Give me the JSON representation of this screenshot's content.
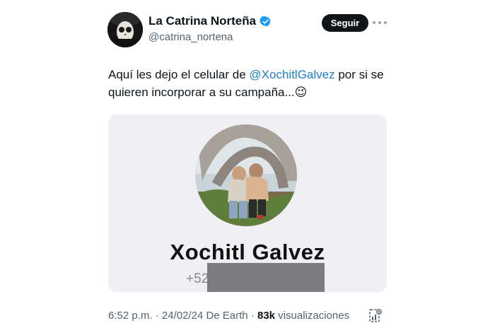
{
  "author": {
    "display_name": "La Catrina Norteña",
    "handle": "@catrina_nortena",
    "verified_icon": "verified-badge-icon",
    "accent_color": "#1d9bf0"
  },
  "follow_button": {
    "label": "Seguir"
  },
  "more_menu": {
    "icon": "more-dots-icon"
  },
  "tweet": {
    "text_before": "Aquí les dejo el celular de ",
    "mention": "@XochitlGalvez",
    "text_after": " por si se quieren incorporar a su campaña...",
    "emoji": "😉",
    "mention_color": "#1d7fc4"
  },
  "contact_card": {
    "name": "Xochitl Galvez",
    "phone_visible": "+52",
    "redaction_color": "#7c7c80"
  },
  "meta": {
    "time": "6:52 p.m.",
    "separator": "·",
    "date": "24/02/24",
    "source": "De Earth",
    "views_count": "83k",
    "views_label": "visualizaciones"
  },
  "actions": {
    "bookmark_icon": "post-analytics-icon"
  }
}
